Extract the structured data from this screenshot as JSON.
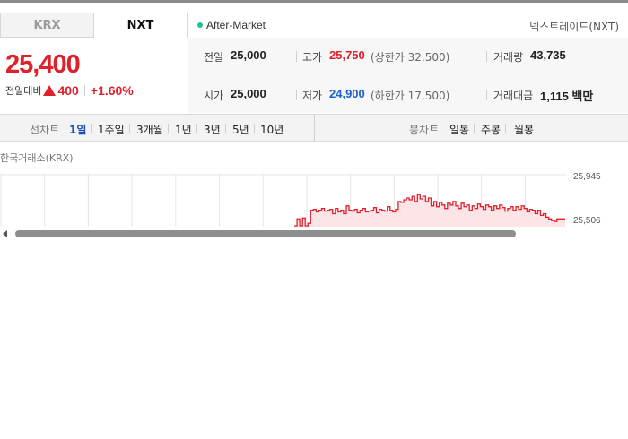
{
  "tabs": [
    {
      "label": "KRX",
      "active": false
    },
    {
      "label": "NXT",
      "active": true
    }
  ],
  "session": {
    "label": "After-Market",
    "dot_color": "#1fbf9a"
  },
  "exchange": {
    "name": "넥스트레이드(NXT)"
  },
  "quote": {
    "price": "25,400",
    "change_label": "전일대비",
    "change_value": "400",
    "change_percent": "+1.60%",
    "direction": "up",
    "up_color": "#e0202a"
  },
  "stats": {
    "prev_close": {
      "label": "전일",
      "value": "25,000"
    },
    "open": {
      "label": "시가",
      "value": "25,000"
    },
    "high": {
      "label": "고가",
      "value": "25,750",
      "note": "(상한가 32,500)"
    },
    "low": {
      "label": "저가",
      "value": "24,900",
      "note": "(하한가 17,500)"
    },
    "volume": {
      "label": "거래량",
      "value": "43,735"
    },
    "trade_value": {
      "label": "거래대금",
      "value": "1,115 백만"
    }
  },
  "chart_tabs": {
    "line_title": "선차트",
    "line_periods": [
      "1일",
      "1주일",
      "3개월",
      "1년",
      "3년",
      "5년",
      "10년"
    ],
    "active_period": "1일",
    "candle_title": "봉차트",
    "candle_periods": [
      "일봉",
      "주봉",
      "월봉"
    ]
  },
  "market_name": "한국거래소(KRX)",
  "chart_data": {
    "type": "area",
    "y_ticks": [
      "25,945",
      "25,506"
    ],
    "ylim": [
      25400,
      26060
    ],
    "grid": true,
    "line_color": "#e0202a",
    "fill_color": "#fde4e6",
    "x": [
      0,
      1,
      2,
      3,
      4,
      5,
      6,
      7,
      8,
      9,
      10,
      11,
      12,
      13,
      14,
      15,
      16,
      17,
      18,
      19,
      20,
      21,
      22,
      23,
      24,
      25,
      26,
      27,
      28,
      29,
      30,
      31,
      32,
      33,
      34,
      35,
      36,
      37,
      38,
      39,
      40,
      41,
      42,
      43,
      44,
      45,
      46,
      47,
      48,
      49,
      50,
      51,
      52,
      53,
      54,
      55,
      56,
      57,
      58,
      59,
      60,
      61,
      62,
      63,
      64,
      65,
      66,
      67,
      68,
      69,
      70,
      71,
      72,
      73,
      74,
      75,
      76,
      77,
      78,
      79,
      80,
      81,
      82,
      83,
      84,
      85,
      86,
      87,
      88,
      89,
      90,
      91,
      92,
      93,
      94,
      95,
      96,
      97,
      98,
      99
    ],
    "values": [
      25420,
      25500,
      25420,
      25510,
      25420,
      25450,
      25600,
      25610,
      25580,
      25600,
      25620,
      25590,
      25600,
      25610,
      25560,
      25620,
      25580,
      25600,
      25560,
      25650,
      25600,
      25590,
      25610,
      25570,
      25600,
      25620,
      25580,
      25590,
      25600,
      25630,
      25570,
      25610,
      25600,
      25590,
      25640,
      25600,
      25580,
      25610,
      25700,
      25690,
      25720,
      25740,
      25720,
      25760,
      25700,
      25780,
      25730,
      25760,
      25700,
      25740,
      25650,
      25700,
      25640,
      25690,
      25660,
      25620,
      25680,
      25660,
      25700,
      25650,
      25620,
      25680,
      25640,
      25660,
      25600,
      25650,
      25620,
      25670,
      25640,
      25610,
      25660,
      25640,
      25600,
      25650,
      25620,
      25660,
      25630,
      25590,
      25620,
      25640,
      25600,
      25640,
      25610,
      25650,
      25620,
      25580,
      25610,
      25600,
      25560,
      25600,
      25540,
      25560,
      25520,
      25500,
      25480,
      25470,
      25500,
      25500,
      25500,
      25500
    ]
  }
}
